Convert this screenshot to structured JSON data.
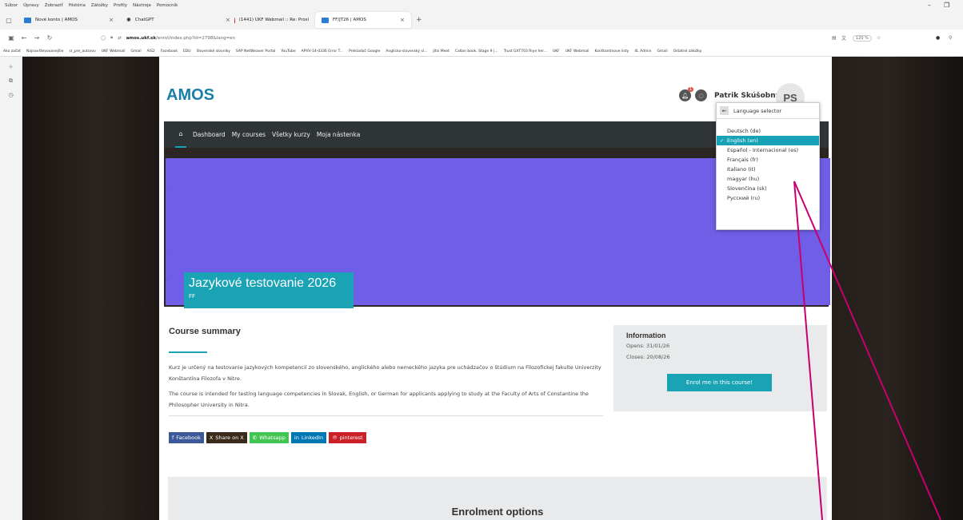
{
  "browser": {
    "menu": [
      "Súbor",
      "Úpravy",
      "Zobraziť",
      "História",
      "Záložky",
      "Profily",
      "Nástroje",
      "Pomocník"
    ],
    "tabs": [
      {
        "label": "Nové konto | AMOS",
        "active": false
      },
      {
        "label": "ChatGPT",
        "active": false
      },
      {
        "label": "(1441) UKF Webmail :: Re: Prosí",
        "active": false
      },
      {
        "label": "FF/JT26 | AMOS",
        "active": true
      }
    ],
    "new_tab": "+",
    "url_host": "amos.ukf.sk",
    "url_path": "/enrol/index.php?id=2798&lang=en",
    "zoom": "120 %",
    "bookmarks": [
      "Ako začať",
      "Najnavštevovanejšie",
      "sr_pre_autorov",
      "UKF Webmail",
      "Gmail",
      "AIS2",
      "Facebook",
      "EDU",
      "Slovenské slovníky",
      "SAP NetWeaver Portal",
      "YouTube",
      "APVV-14-0336 Error T...",
      "Prekladač Google",
      "Anglicko-slovenský sl...",
      "Jitsi Meet",
      "Callan book. Stage 9 |...",
      "Trust GXT703 Riye her...",
      "UKF",
      "UKF Webmail",
      "Konštantínove listy",
      "4L Admin",
      "Gmail",
      "Ostatné záložky"
    ]
  },
  "site": {
    "logo": "AMOS",
    "notification_count": "1",
    "user_name": "Patrik Skúšobný",
    "avatar_initials": "PS",
    "nav": [
      "Dashboard",
      "My courses",
      "Všetky kurzy",
      "Moja nástenka"
    ]
  },
  "course": {
    "title": "Jazykové testovanie 2026",
    "category": "FF",
    "summary_heading": "Course summary",
    "summary_sk": "Kurz je určený na testovanie jazykových kompetencií zo slovenského, anglického alebo nemeckého jazyka pre uchádzačov o štúdium na Filozofickej fakulte Univerzity Konštantína Filozofa v Nitre.",
    "summary_en": "The course is intended for testing language competencies in Slovak, English, or German for applicants applying to study at the Faculty of Arts of Constantine the Philosopher University in Nitra."
  },
  "share": [
    {
      "label": "Facebook",
      "icon": "f",
      "color": "#3b5998"
    },
    {
      "label": "Share on X",
      "icon": "X",
      "color": "#3a2a1a"
    },
    {
      "label": "Whatsapp",
      "icon": "✆",
      "color": "#43c553"
    },
    {
      "label": "LinkedIn",
      "icon": "in",
      "color": "#0077b5"
    },
    {
      "label": "pinterest",
      "icon": "℗",
      "color": "#cb2027"
    }
  ],
  "info": {
    "heading": "Information",
    "opens": "Opens: 31/01/26",
    "closes": "Closes: 20/08/26",
    "enrol_button": "Enrol me in this course!"
  },
  "enrolment_heading": "Enrolment options",
  "language_selector": {
    "title": "Language selector",
    "languages": [
      {
        "label": "Deutsch (de)",
        "selected": false
      },
      {
        "label": "English (en)",
        "selected": true
      },
      {
        "label": "Español - Internacional (es)",
        "selected": false
      },
      {
        "label": "Français (fr)",
        "selected": false
      },
      {
        "label": "Italiano (it)",
        "selected": false
      },
      {
        "label": "magyar (hu)",
        "selected": false
      },
      {
        "label": "Slovenčina (sk)",
        "selected": false
      },
      {
        "label": "Русский (ru)",
        "selected": false
      }
    ]
  },
  "colors": {
    "accent": "#1aa3b5",
    "logo": "#1a7fa8",
    "banner": "#6655e0",
    "annotation": "#c8006e"
  }
}
